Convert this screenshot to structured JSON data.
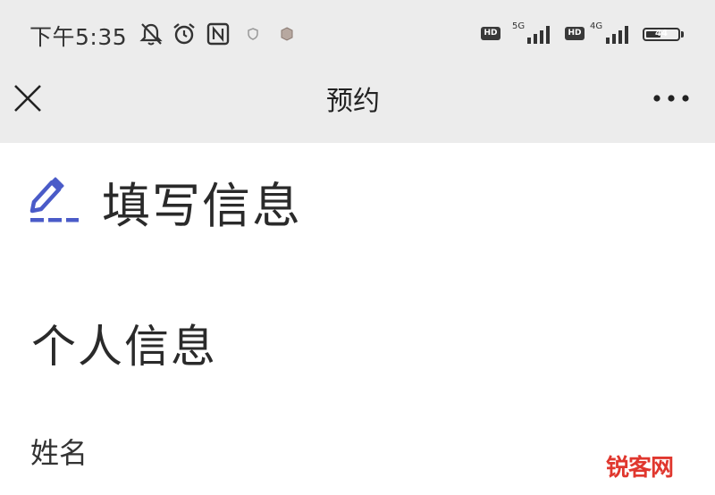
{
  "status_bar": {
    "time": "下午5:35",
    "net1": "5G",
    "net2": "4G",
    "hd": "HD",
    "battery": "44"
  },
  "nav": {
    "title": "预约"
  },
  "form": {
    "heading": "填写信息",
    "section_title": "个人信息",
    "name_label": "姓名",
    "accent_color": "#4a5bc8"
  },
  "watermark": "锐客网"
}
